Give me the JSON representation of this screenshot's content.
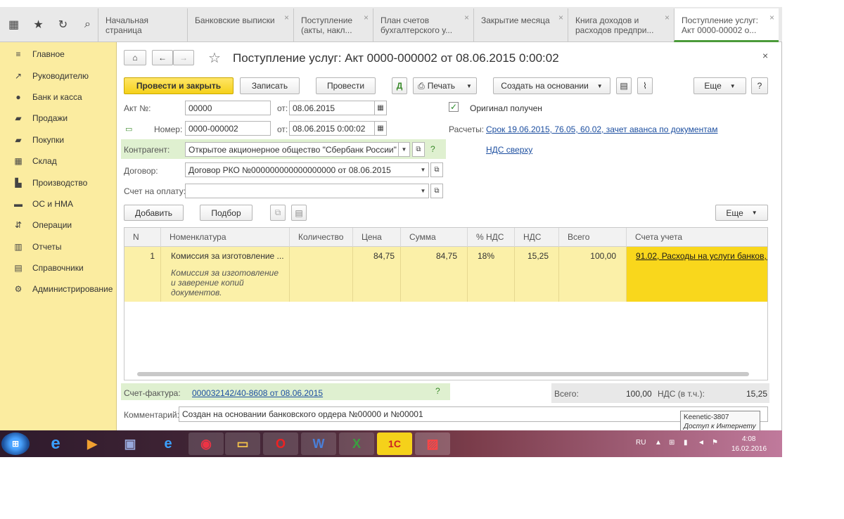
{
  "tabs": [
    {
      "label": "Начальная страница",
      "closable": false
    },
    {
      "label": "Банковские выписки",
      "closable": true
    },
    {
      "label": "Поступление (акты, накл...",
      "closable": true
    },
    {
      "label": "План счетов бухгалтерского у...",
      "closable": true
    },
    {
      "label": "Закрытие месяца",
      "closable": true
    },
    {
      "label": "Книга доходов и расходов предпри...",
      "closable": true
    },
    {
      "label": "Поступление услуг: Акт 0000-00002 о...",
      "closable": true,
      "active": true
    }
  ],
  "sidebar": {
    "items": [
      {
        "label": "Главное",
        "icon": "menu-lines-icon"
      },
      {
        "label": "Руководителю",
        "icon": "chart-trend-icon"
      },
      {
        "label": "Банк и касса",
        "icon": "bank-icon"
      },
      {
        "label": "Продажи",
        "icon": "sales-icon"
      },
      {
        "label": "Покупки",
        "icon": "cart-icon"
      },
      {
        "label": "Склад",
        "icon": "warehouse-icon"
      },
      {
        "label": "Производство",
        "icon": "factory-icon"
      },
      {
        "label": "ОС и НМА",
        "icon": "assets-icon"
      },
      {
        "label": "Операции",
        "icon": "operations-icon"
      },
      {
        "label": "Отчеты",
        "icon": "reports-icon"
      },
      {
        "label": "Справочники",
        "icon": "books-icon"
      },
      {
        "label": "Администрирование",
        "icon": "gear-icon"
      }
    ]
  },
  "form": {
    "title": "Поступление услуг: Акт 0000-000002 от 08.06.2015 0:00:02",
    "buttons": {
      "post_close": "Провести и закрыть",
      "save": "Записать",
      "post": "Провести",
      "print": "Печать",
      "create_based": "Создать на основании",
      "more": "Еще",
      "help": "?"
    },
    "act_label": "Акт №:",
    "act_value": "00000",
    "from_label": "от:",
    "act_date": "08.06.2015",
    "number_label": "Номер:",
    "number_value": "0000-000002",
    "number_date": "08.06.2015  0:00:02",
    "original_label": "Оригинал получен",
    "settlements_label": "Расчеты:",
    "settlements_link": "Срок 19.06.2015, 76.05, 60.02, зачет аванса по документам",
    "vat_link": "НДС сверху",
    "contractor_label": "Контрагент:",
    "contractor_value": "Открытое акционерное общество \"Сбербанк России\"",
    "contract_label": "Договор:",
    "contract_value": "Договор РКО №000000000000000000 от 08.06.2015",
    "invoice_pay_label": "Счет на оплату:",
    "invoice_pay_value": "",
    "add_button": "Добавить",
    "pick_button": "Подбор",
    "more2": "Еще",
    "question": "?"
  },
  "table": {
    "headers": [
      "N",
      "Номенклатура",
      "Количество",
      "Цена",
      "Сумма",
      "% НДС",
      "НДС",
      "Всего",
      "Счета учета"
    ],
    "rows": [
      {
        "n": "1",
        "item": "Комиссия за изготовление ...",
        "item_desc_1": "Комиссия за изготовление",
        "item_desc_2": "и заверение копий",
        "item_desc_3": "документов.",
        "qty": "",
        "price": "84,75",
        "sum": "84,75",
        "vat_rate": "18%",
        "vat": "15,25",
        "total": "100,00",
        "account": "91.02, Расходы на услуги банков, <"
      }
    ]
  },
  "footer": {
    "invoice_label": "Счет-фактура:",
    "invoice_link": "000032142/40-8608 от 08.06.2015",
    "invoice_q": "?",
    "total_label": "Всего:",
    "total_value": "100,00",
    "vat_label": "НДС (в т.ч.):",
    "vat_value": "15,25",
    "comment_label": "Комментарий:",
    "comment_value": "Создан на основании банковского ордера №00000 и №00001"
  },
  "tooltip": {
    "line1": "Keenetic-3807",
    "line2": "Доступ к Интернету"
  },
  "taskbar": {
    "lang": "RU",
    "time": "4:08",
    "date": "16.02.2016"
  },
  "colors": {
    "sidebar_bg": "#fbeca0",
    "primary_button": "#f5d11a",
    "selected_row": "#fbf0a8",
    "account_cell": "#f9d71c",
    "link": "#1d4fa0",
    "green_highlight": "#dff0d0"
  }
}
